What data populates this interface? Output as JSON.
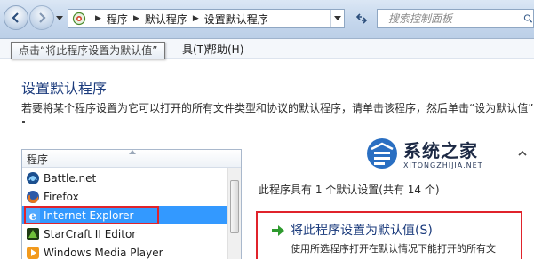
{
  "address_bar": {
    "crumbs": [
      "程序",
      "默认程序",
      "设置默认程序"
    ]
  },
  "search": {
    "placeholder": "搜索控制面板"
  },
  "menu": {
    "tools_fragment": "具(T)",
    "help": "帮助(H)"
  },
  "tooltip": {
    "text": "点击“将此程序设置为默认值”"
  },
  "page": {
    "title": "设置默认程序",
    "description": "若要将某个程序设置为它可以打开的所有文件类型和协议的默认程序，请单击该程序，然后单击“设为默认值”"
  },
  "program_list": {
    "header": "程序",
    "items": [
      {
        "label": "Battle.net",
        "icon": "battlenet-icon"
      },
      {
        "label": "Firefox",
        "icon": "firefox-icon"
      },
      {
        "label": "Internet Explorer",
        "icon": "ie-icon",
        "selected": true
      },
      {
        "label": "StarCraft II Editor",
        "icon": "starcraft-icon"
      },
      {
        "label": "Windows Media Player",
        "icon": "wmp-icon"
      }
    ]
  },
  "details": {
    "defaults_count": "此程序具有 1 个默认设置(共有 14 个)",
    "set_default_title": "将此程序设置为默认值(S)",
    "set_default_desc": "使用所选程序打开在默认情况下能打开的所有文"
  },
  "watermark": {
    "name": "系统之家",
    "url": "XITONGZHIJIA.NET"
  },
  "colors": {
    "selection": "#3399ff",
    "highlight_border": "#e0232b",
    "title": "#1b3b7c"
  }
}
